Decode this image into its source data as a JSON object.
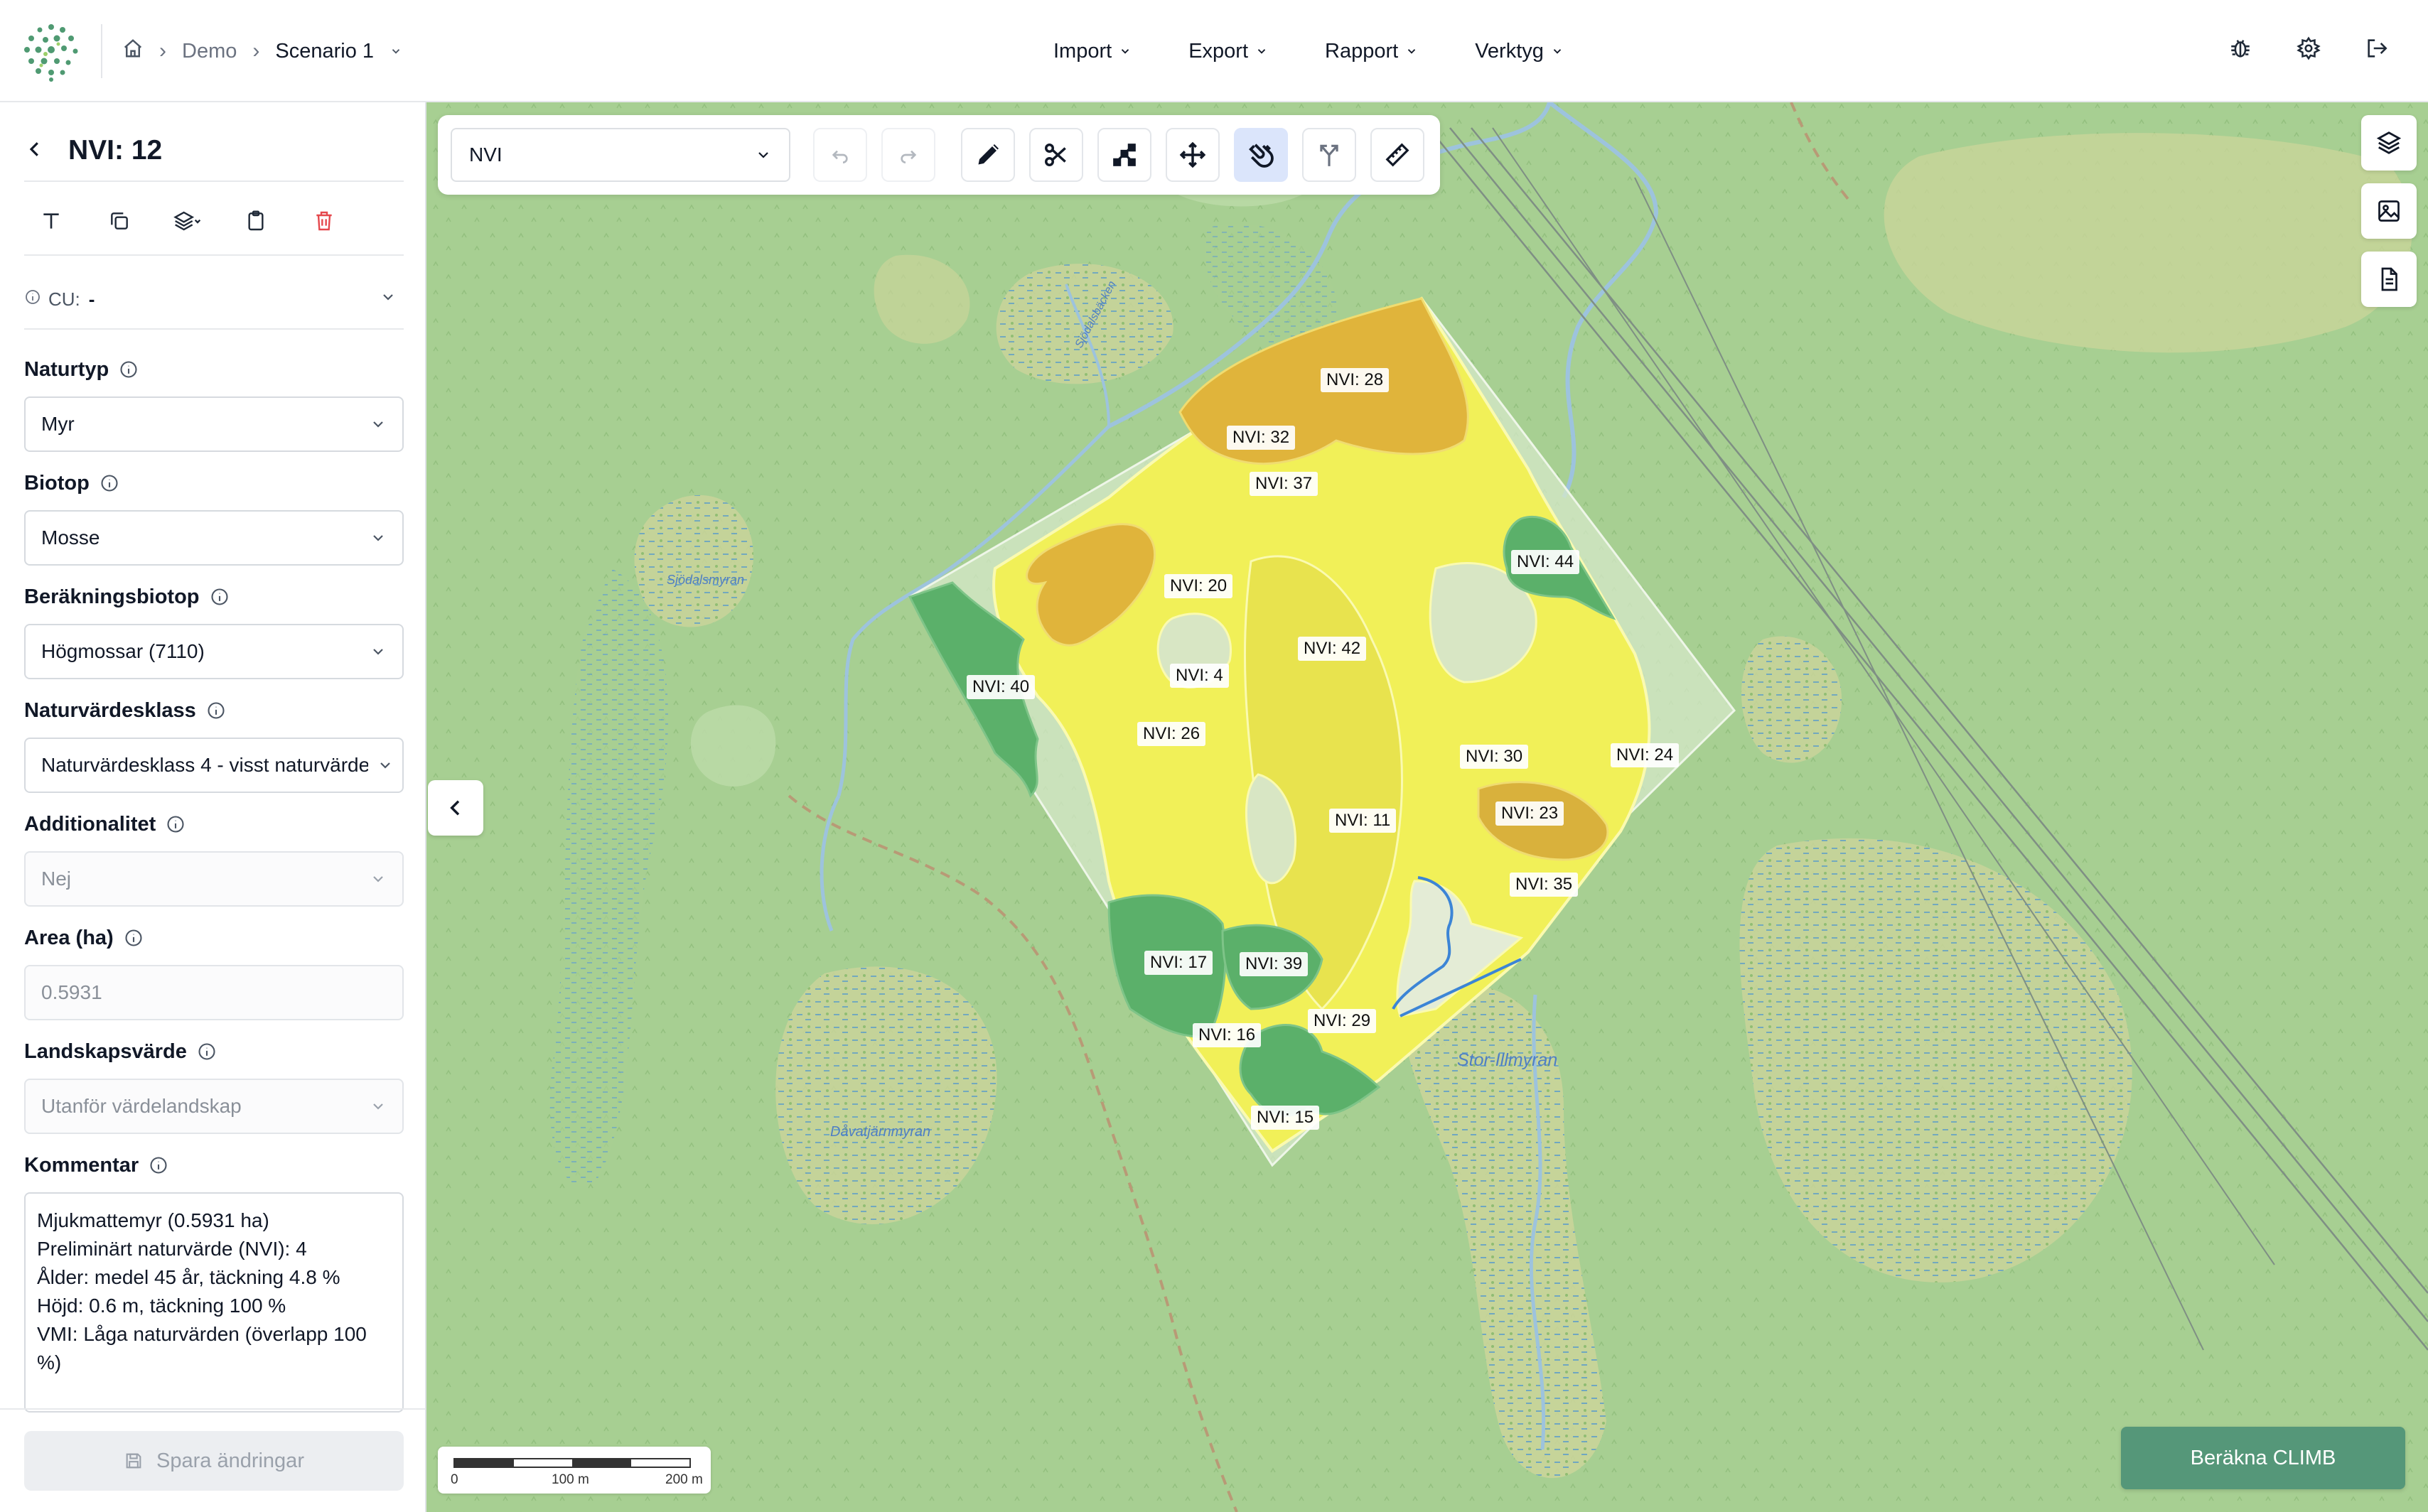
{
  "breadcrumb": {
    "project": "Demo",
    "scenario": "Scenario 1"
  },
  "menu": [
    "Import",
    "Export",
    "Rapport",
    "Verktyg"
  ],
  "sidebar": {
    "title": "NVI: 12",
    "cu_label": "CU:",
    "cu_value": "-",
    "fields": {
      "naturtyp": {
        "label": "Naturtyp",
        "value": "Myr"
      },
      "biotop": {
        "label": "Biotop",
        "value": "Mosse"
      },
      "berakningsbiotop": {
        "label": "Beräkningsbiotop",
        "value": "Högmossar (7110)"
      },
      "naturvardesklass": {
        "label": "Naturvärdesklass",
        "value": "Naturvärdesklass 4 - visst naturvärde"
      },
      "additionalitet": {
        "label": "Additionalitet",
        "value": "Nej"
      },
      "area": {
        "label": "Area (ha)",
        "value": "0.5931"
      },
      "landskapsvarde": {
        "label": "Landskapsvärde",
        "value": "Utanför värdelandskap"
      },
      "kommentar": {
        "label": "Kommentar",
        "value": "Mjukmattemyr (0.5931 ha)\nPreliminärt naturvärde (NVI): 4\nÅlder: medel 45 år, täckning 4.8 %\nHöjd: 0.6 m, täckning 100 %\nVMI: Låga naturvärden (överlapp 100 %)"
      }
    },
    "save_label": "Spara ändringar"
  },
  "map": {
    "layer_select": "NVI",
    "calc_button": "Beräkna CLIMB",
    "scale": {
      "start": "0",
      "mid": "100 m",
      "end": "200 m"
    },
    "places": [
      "Sjödalsmyran",
      "Dåvatjärnmyran",
      "Stor-Illmyran",
      "Sjödalsbäcken"
    ],
    "polygon_labels": [
      "NVI: 28",
      "NVI: 32",
      "NVI: 37",
      "NVI: 44",
      "NVI: 20",
      "NVI: 42",
      "NVI: 4",
      "NVI: 40",
      "NVI: 26",
      "NVI: 30",
      "NVI: 24",
      "NVI: 23",
      "NVI: 11",
      "NVI: 35",
      "NVI: 17",
      "NVI: 39",
      "NVI: 29",
      "NVI: 16",
      "NVI: 15"
    ]
  },
  "colors": {
    "accent": "#559779",
    "danger": "#e5484d",
    "active_tool": "#dbe5fb"
  }
}
